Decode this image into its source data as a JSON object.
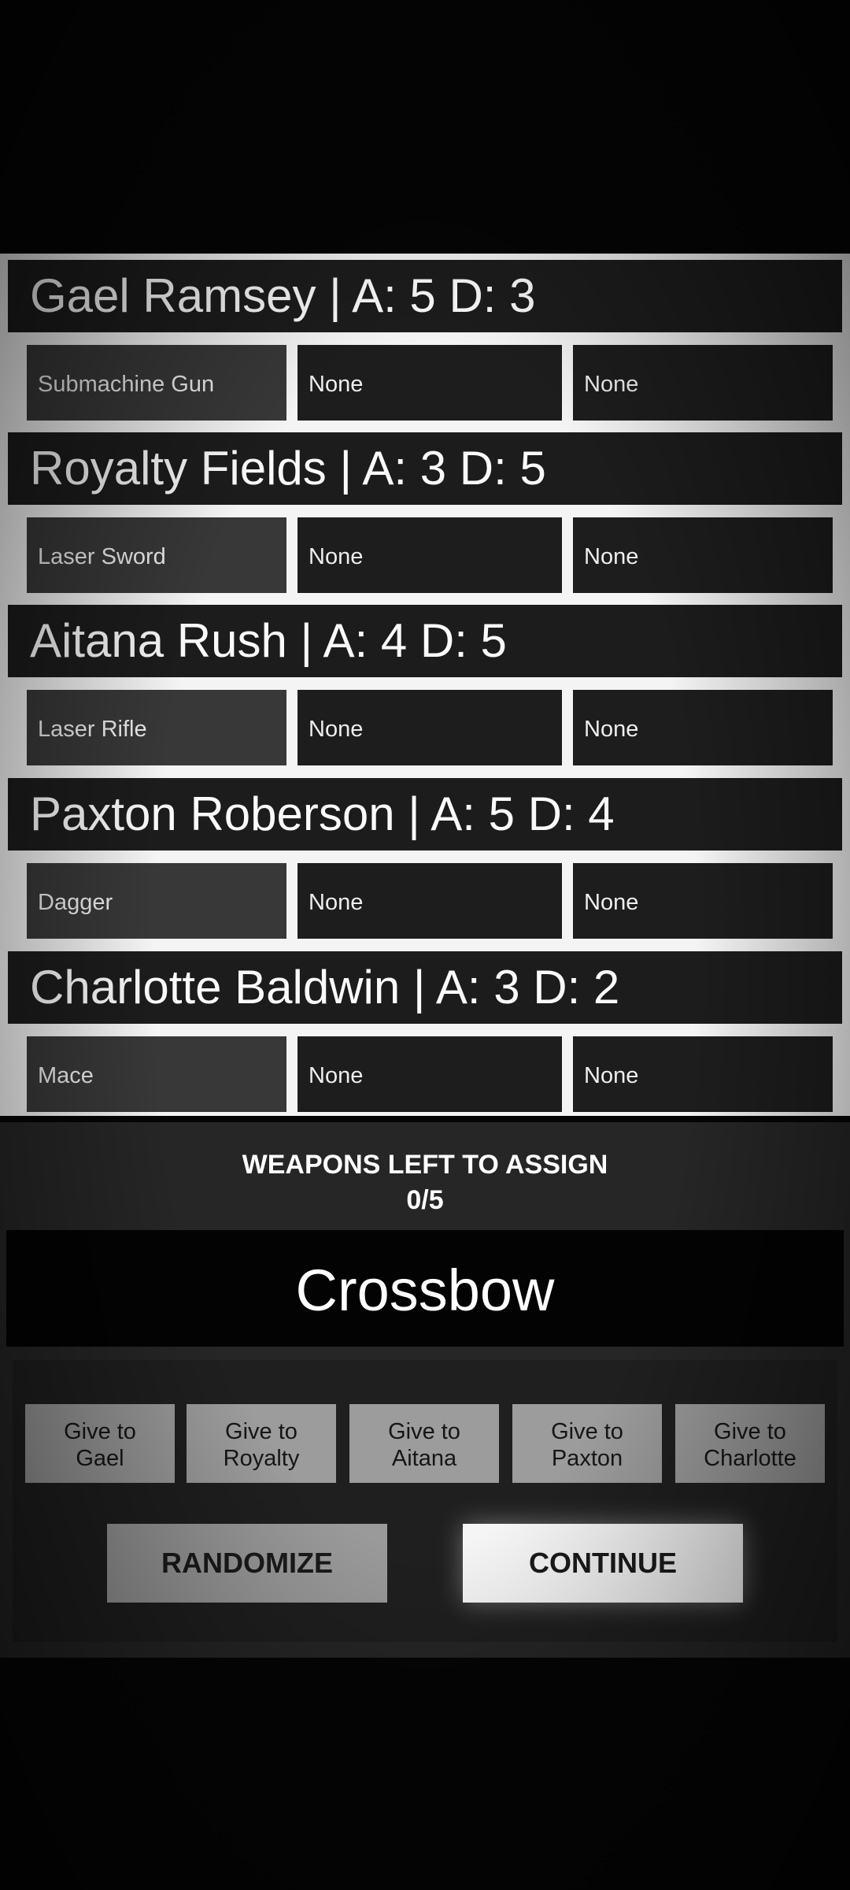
{
  "characters": [
    {
      "title": "Gael Ramsey | A: 5 D: 3",
      "slots": [
        "Submachine Gun",
        "None",
        "None"
      ]
    },
    {
      "title": "Royalty Fields | A: 3 D: 5",
      "slots": [
        "Laser Sword",
        "None",
        "None"
      ]
    },
    {
      "title": "Aitana Rush | A: 4 D: 5",
      "slots": [
        "Laser Rifle",
        "None",
        "None"
      ]
    },
    {
      "title": "Paxton Roberson | A: 5 D: 4",
      "slots": [
        "Dagger",
        "None",
        "None"
      ]
    },
    {
      "title": "Charlotte Baldwin | A: 3 D: 2",
      "slots": [
        "Mace",
        "None",
        "None"
      ]
    }
  ],
  "assign": {
    "label": "WEAPONS LEFT TO ASSIGN",
    "count": "0/5",
    "current_weapon": "Crossbow"
  },
  "give_buttons": [
    "Give to\nGael",
    "Give to\nRoyalty",
    "Give to\nAitana",
    "Give to\nPaxton",
    "Give to\nCharlotte"
  ],
  "actions": {
    "randomize": "RANDOMIZE",
    "continue": "CONTINUE"
  }
}
